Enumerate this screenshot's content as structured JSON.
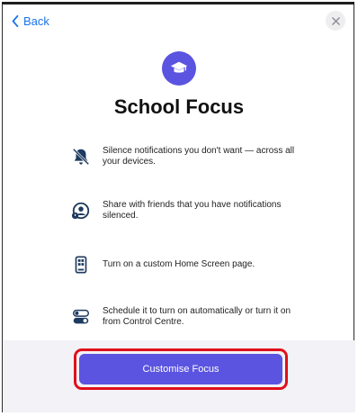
{
  "nav": {
    "back_label": "Back"
  },
  "header": {
    "title": "School Focus"
  },
  "features": [
    {
      "text": "Silence notifications you don't want — across all your devices.",
      "icon": "bell-slash-icon"
    },
    {
      "text": "Share with friends that you have notifications silenced.",
      "icon": "share-status-icon"
    },
    {
      "text": "Turn on a custom Home Screen page.",
      "icon": "home-screen-page-icon"
    },
    {
      "text": "Schedule it to turn on automatically or turn it on from Control Centre.",
      "icon": "toggle-switches-icon"
    }
  ],
  "footer": {
    "cta_label": "Customise Focus"
  },
  "colors": {
    "accent": "#5b54e0",
    "link": "#1a73e8",
    "highlight": "#e0101a",
    "footer_bg": "#f2f2f7"
  }
}
